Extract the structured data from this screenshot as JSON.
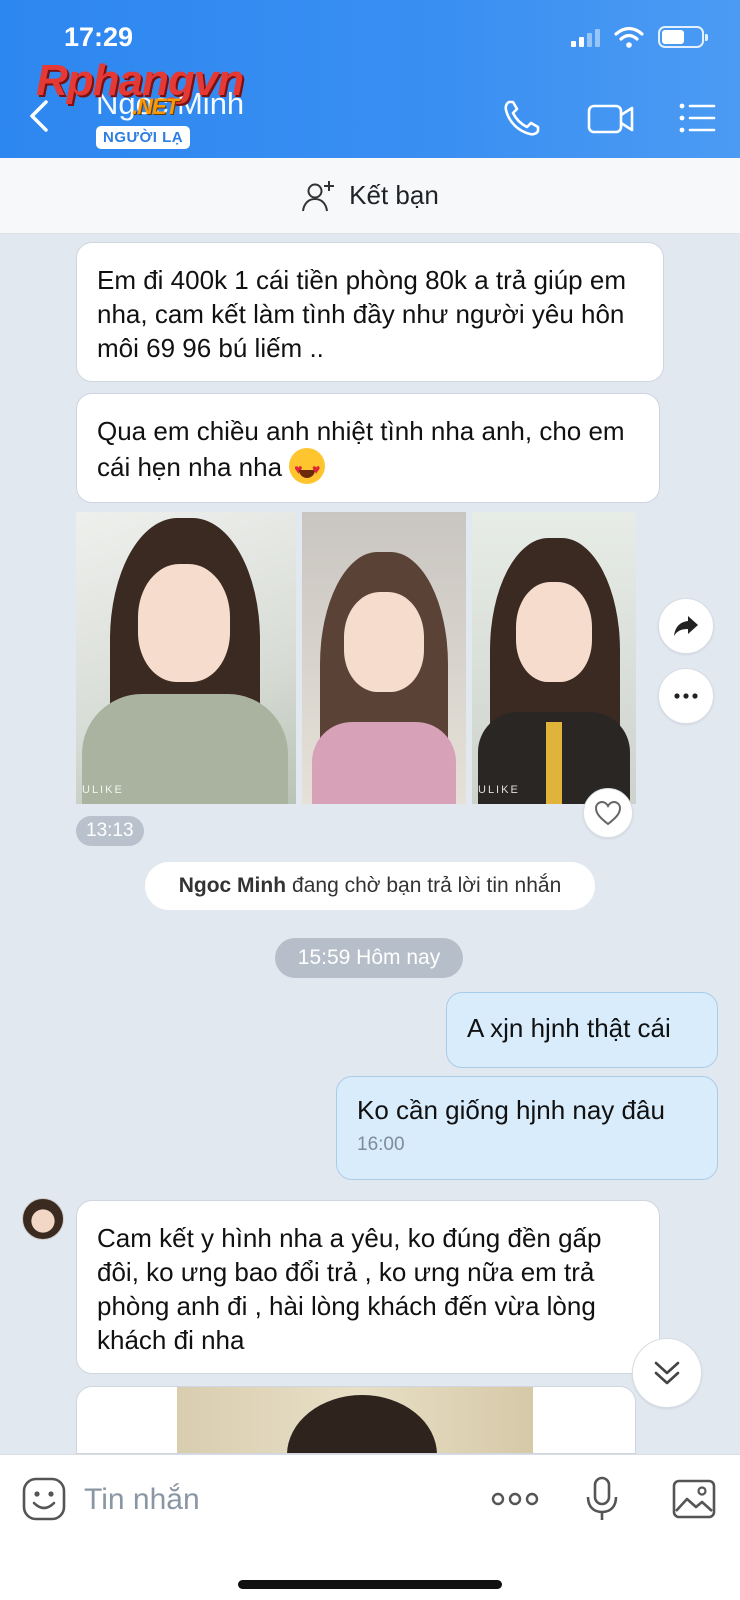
{
  "status_bar": {
    "time": "17:29"
  },
  "header": {
    "watermark_main": "Rphangvn",
    "watermark_sub": ".NET",
    "contact_name": "Ngoc Minh",
    "badge": "NGƯỜI LẠ",
    "icons": [
      "back-icon",
      "phone-icon",
      "video-icon",
      "menu-list-icon"
    ]
  },
  "friend_bar": {
    "label": "Kết bạn",
    "icon": "add-friend-icon"
  },
  "messages": {
    "m1": "Em đi 400k 1 cái tiền phòng 80k a trả giúp em nha, cam kết làm tình đầy  như người yêu hôn môi 69 96 bú liếm ..",
    "m2": "Qua em chiều anh nhiệt tình nha anh, cho em cái hẹn nha nha",
    "photos_time": "13:13",
    "photo_watermark": "ULIKE",
    "system_name": "Ngoc Minh",
    "system_text": "đang chờ bạn trả lời tin nhắn",
    "date_divider": "15:59 Hôm nay",
    "sent1": "A xjn hjnh thật cái",
    "sent2": "Ko cần giống hjnh nay đâu",
    "sent2_time": "16:00",
    "m3": "Cam kết y hình nha a yêu, ko đúng đền gấp đôi, ko ưng bao đổi trả , ko ưng nữa em trả phòng anh đi  , hài lòng khách đến vừa lòng khách đi nha"
  },
  "input_bar": {
    "placeholder": "Tin nhắn"
  },
  "colors": {
    "header": "#3a8ff2",
    "sent_bubble": "#d8ecfc",
    "background": "#e2e8f0"
  }
}
